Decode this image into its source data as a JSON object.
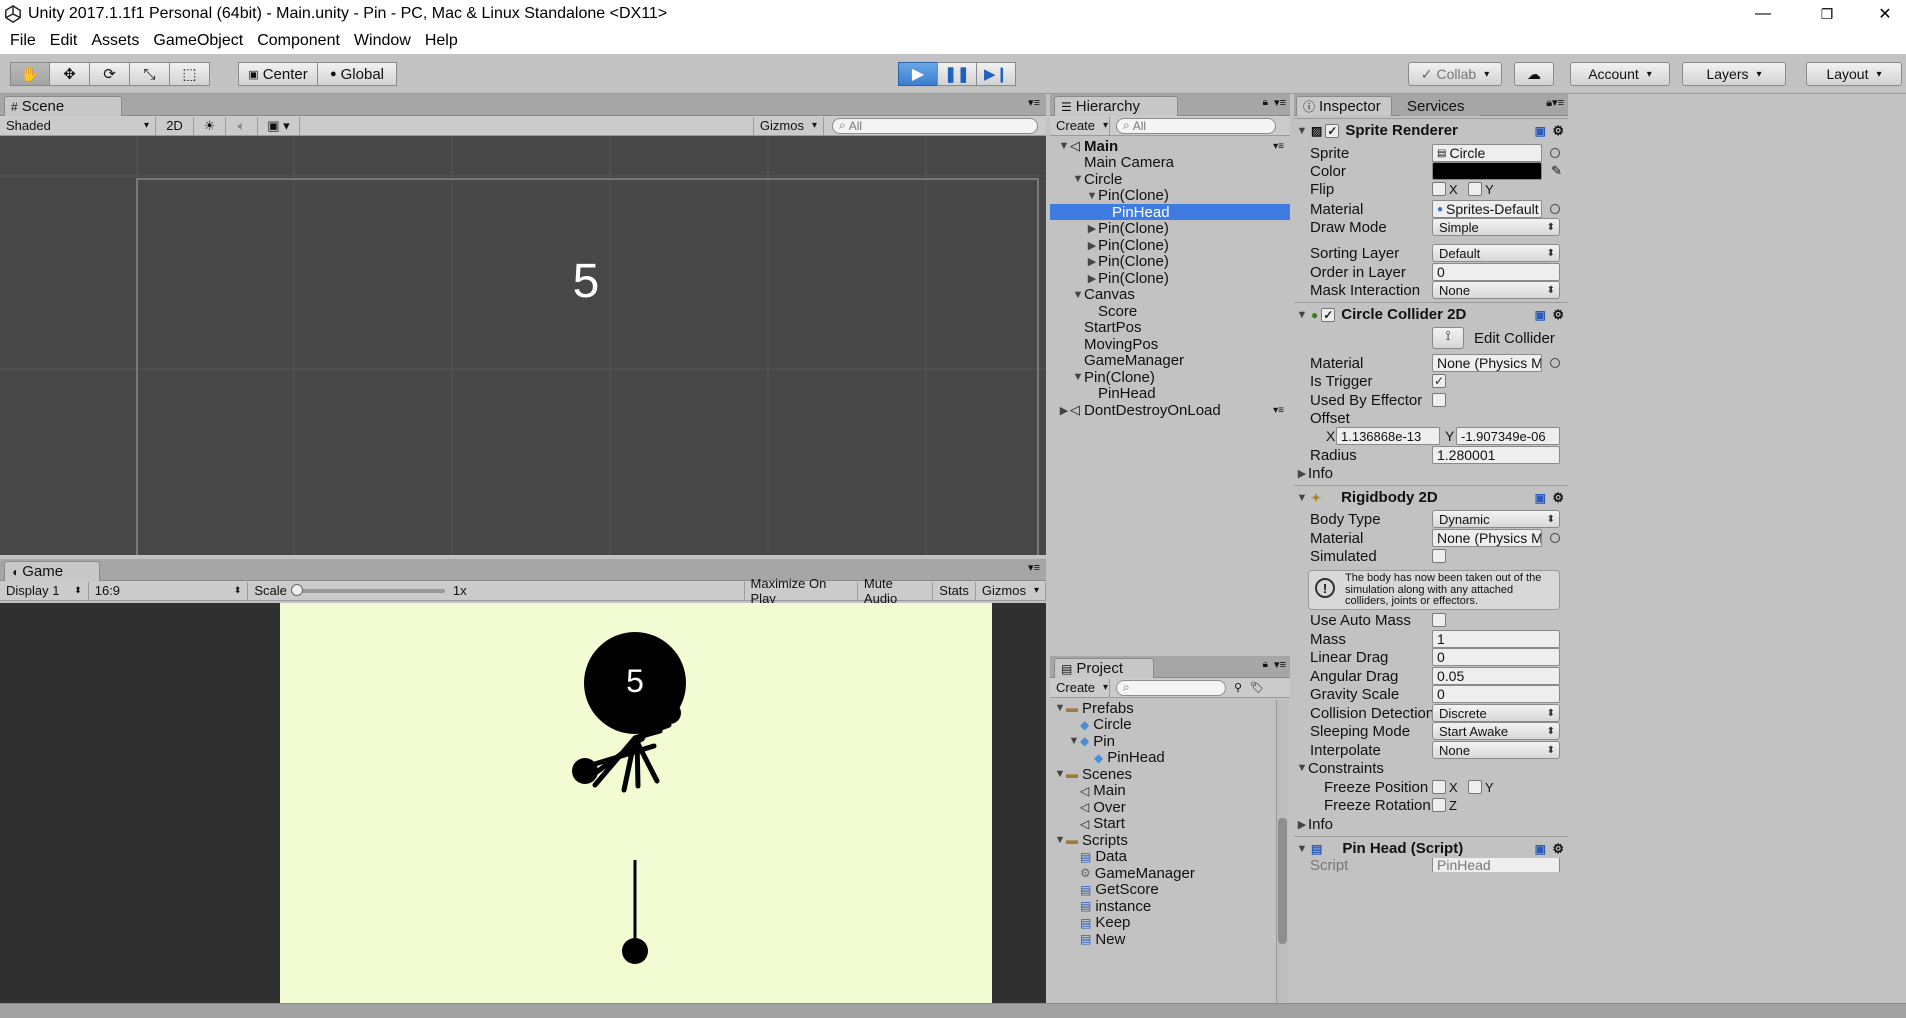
{
  "window": {
    "title": "Unity 2017.1.1f1 Personal (64bit) - Main.unity - Pin - PC, Mac & Linux Standalone <DX11>",
    "minimize": "—",
    "maximize": "❐",
    "close": "✕"
  },
  "menu": [
    "File",
    "Edit",
    "Assets",
    "GameObject",
    "Component",
    "Window",
    "Help"
  ],
  "toolbar": {
    "center": "Center",
    "global": "Global",
    "collab": "Collab",
    "account": "Account",
    "layers": "Layers",
    "layout": "Layout"
  },
  "scene": {
    "tab": "Scene",
    "shading": "Shaded",
    "mode2d": "2D",
    "gizmos": "Gizmos",
    "search_placeholder": "All",
    "overlay_text": "5"
  },
  "game": {
    "tab": "Game",
    "display": "Display 1",
    "aspect": "16:9",
    "scale_label": "Scale",
    "scale_value": "1x",
    "maximize": "Maximize On Play",
    "mute": "Mute Audio",
    "stats": "Stats",
    "gizmos": "Gizmos",
    "circle_text": "5",
    "background_color": "#f3fbd3"
  },
  "hierarchy": {
    "tab": "Hierarchy",
    "create": "Create",
    "search_placeholder": "All",
    "items": [
      {
        "label": "Main",
        "indent": 0,
        "arrow": "▼",
        "bold": true
      },
      {
        "label": "Main Camera",
        "indent": 1,
        "arrow": ""
      },
      {
        "label": "Circle",
        "indent": 1,
        "arrow": "▼"
      },
      {
        "label": "Pin(Clone)",
        "indent": 2,
        "arrow": "▼"
      },
      {
        "label": "PinHead",
        "indent": 3,
        "arrow": "",
        "selected": true
      },
      {
        "label": "Pin(Clone)",
        "indent": 2,
        "arrow": "▶"
      },
      {
        "label": "Pin(Clone)",
        "indent": 2,
        "arrow": "▶"
      },
      {
        "label": "Pin(Clone)",
        "indent": 2,
        "arrow": "▶"
      },
      {
        "label": "Pin(Clone)",
        "indent": 2,
        "arrow": "▶"
      },
      {
        "label": "Canvas",
        "indent": 1,
        "arrow": "▼"
      },
      {
        "label": "Score",
        "indent": 2,
        "arrow": ""
      },
      {
        "label": "StartPos",
        "indent": 1,
        "arrow": ""
      },
      {
        "label": "MovingPos",
        "indent": 1,
        "arrow": ""
      },
      {
        "label": "GameManager",
        "indent": 1,
        "arrow": ""
      },
      {
        "label": "Pin(Clone)",
        "indent": 1,
        "arrow": "▼"
      },
      {
        "label": "PinHead",
        "indent": 2,
        "arrow": ""
      },
      {
        "label": "DontDestroyOnLoad",
        "indent": 0,
        "arrow": "▶"
      }
    ]
  },
  "project": {
    "tab": "Project",
    "create": "Create",
    "items": [
      {
        "label": "Prefabs",
        "indent": 0,
        "arrow": "▼",
        "icon": "folder"
      },
      {
        "label": "Circle",
        "indent": 1,
        "arrow": "",
        "icon": "prefab"
      },
      {
        "label": "Pin",
        "indent": 1,
        "arrow": "▼",
        "icon": "prefab"
      },
      {
        "label": "PinHead",
        "indent": 2,
        "arrow": "",
        "icon": "prefab"
      },
      {
        "label": "Scenes",
        "indent": 0,
        "arrow": "▼",
        "icon": "folder"
      },
      {
        "label": "Main",
        "indent": 1,
        "arrow": "",
        "icon": "scene"
      },
      {
        "label": "Over",
        "indent": 1,
        "arrow": "",
        "icon": "scene"
      },
      {
        "label": "Start",
        "indent": 1,
        "arrow": "",
        "icon": "scene"
      },
      {
        "label": "Scripts",
        "indent": 0,
        "arrow": "▼",
        "icon": "folder"
      },
      {
        "label": "Data",
        "indent": 1,
        "arrow": "",
        "icon": "script"
      },
      {
        "label": "GameManager",
        "indent": 1,
        "arrow": "",
        "icon": "gear"
      },
      {
        "label": "GetScore",
        "indent": 1,
        "arrow": "",
        "icon": "script"
      },
      {
        "label": "instance",
        "indent": 1,
        "arrow": "",
        "icon": "script"
      },
      {
        "label": "Keep",
        "indent": 1,
        "arrow": "",
        "icon": "script"
      },
      {
        "label": "New",
        "indent": 1,
        "arrow": "",
        "icon": "script"
      }
    ]
  },
  "inspector": {
    "tab": "Inspector",
    "services_tab": "Services",
    "sprite_renderer": {
      "title": "Sprite Renderer",
      "sprite_label": "Sprite",
      "sprite_value": "Circle",
      "color_label": "Color",
      "color_value": "#000000",
      "flip_label": "Flip",
      "flip_x": "X",
      "flip_y": "Y",
      "material_label": "Material",
      "material_value": "Sprites-Default",
      "draw_mode_label": "Draw Mode",
      "draw_mode_value": "Simple",
      "sorting_layer_label": "Sorting Layer",
      "sorting_layer_value": "Default",
      "order_label": "Order in Layer",
      "order_value": "0",
      "mask_label": "Mask Interaction",
      "mask_value": "None"
    },
    "circle_collider": {
      "title": "Circle Collider 2D",
      "edit_collider": "Edit Collider",
      "material_label": "Material",
      "material_value": "None (Physics Mat",
      "trigger_label": "Is Trigger",
      "trigger_checked": "✓",
      "effector_label": "Used By Effector",
      "offset_label": "Offset",
      "offset_x_label": "X",
      "offset_x": "1.136868e-13",
      "offset_y_label": "Y",
      "offset_y": "-1.907349e-06",
      "radius_label": "Radius",
      "radius_value": "1.280001",
      "info_label": "Info"
    },
    "rigidbody": {
      "title": "Rigidbody 2D",
      "body_type_label": "Body Type",
      "body_type_value": "Dynamic",
      "material_label": "Material",
      "material_value": "None (Physics Mat",
      "simulated_label": "Simulated",
      "warning": "The body has now been taken out of the simulation along with any attached colliders, joints or effectors.",
      "auto_mass_label": "Use Auto Mass",
      "mass_label": "Mass",
      "mass_value": "1",
      "linear_drag_label": "Linear Drag",
      "linear_drag_value": "0",
      "angular_drag_label": "Angular Drag",
      "angular_drag_value": "0.05",
      "gravity_label": "Gravity Scale",
      "gravity_value": "0",
      "collision_label": "Collision Detection",
      "collision_value": "Discrete",
      "sleeping_label": "Sleeping Mode",
      "sleeping_value": "Start Awake",
      "interpolate_label": "Interpolate",
      "interpolate_value": "None",
      "constraints_label": "Constraints",
      "freeze_pos_label": "Freeze Position",
      "freeze_pos_x": "X",
      "freeze_pos_y": "Y",
      "freeze_rot_label": "Freeze Rotation",
      "freeze_rot_z": "Z",
      "info_label": "Info"
    },
    "pinhead_script": {
      "title": "Pin Head (Script)",
      "script_label": "Script",
      "script_value": "PinHead"
    }
  }
}
